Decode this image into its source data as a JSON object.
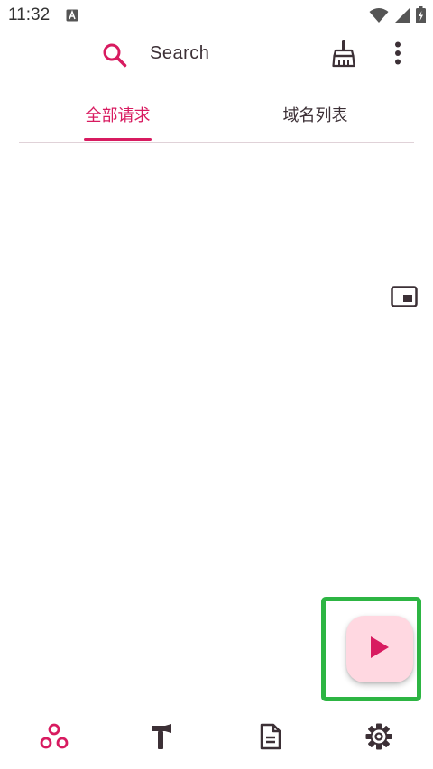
{
  "status_bar": {
    "time": "11:32",
    "icons": [
      "text-notification-icon",
      "wifi-icon",
      "signal-icon",
      "battery-charging-icon"
    ]
  },
  "toolbar": {
    "search_label": "Search",
    "icons": [
      "search-icon",
      "broom-icon",
      "more-vert-icon"
    ]
  },
  "tabs": [
    {
      "label": "全部请求",
      "selected": true
    },
    {
      "label": "域名列表",
      "selected": false
    }
  ],
  "actions": {
    "pip_icon": "picture-in-picture-icon",
    "fab_icon": "play-icon"
  },
  "bottom_nav": {
    "items": [
      {
        "icon": "network-nodes-icon",
        "selected": true
      },
      {
        "icon": "hammer-icon",
        "selected": false
      },
      {
        "icon": "document-icon",
        "selected": false
      },
      {
        "icon": "gear-icon",
        "selected": false
      }
    ]
  },
  "colors": {
    "accent": "#d81b60",
    "fab_background": "#ffd8e1",
    "highlight": "#2db543",
    "icon": "#3c3036"
  }
}
